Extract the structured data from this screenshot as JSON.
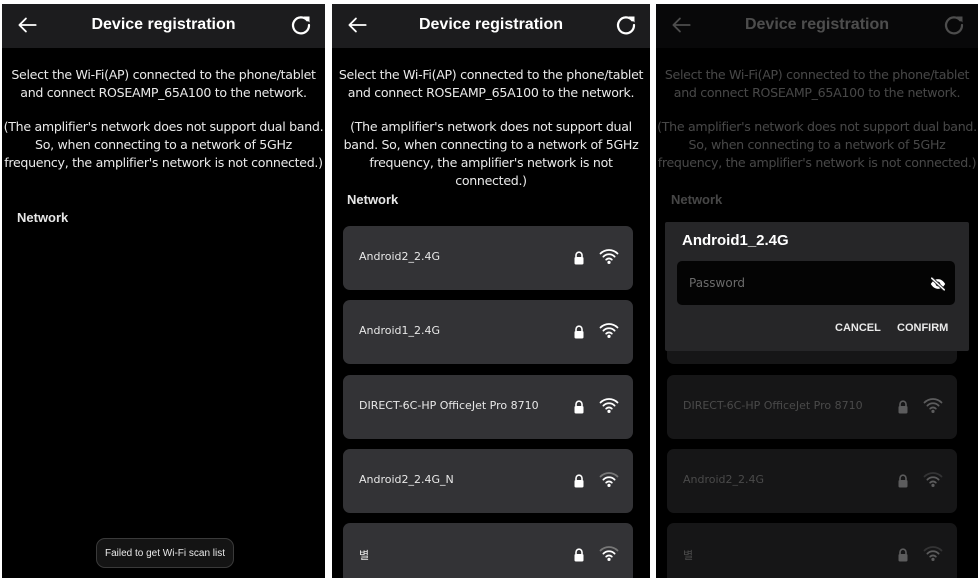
{
  "screens": [
    {
      "title": "Device registration",
      "description": [
        "Select the Wi-Fi(AP) connected to the phone/tablet and connect ROSEAMP_65A100 to the network.",
        "(The amplifier's network does not support dual band. So, when connecting to a network of 5GHz frequency, the amplifier's network is not connected.)"
      ],
      "network_label": "Network",
      "toast": "Failed to get Wi-Fi scan list"
    },
    {
      "title": "Device registration",
      "description": [
        "Select the Wi-Fi(AP) connected to the phone/tablet and connect ROSEAMP_65A100 to the network.",
        "(The amplifier's network does not support dual band. So, when connecting to a network of 5GHz frequency, the amplifier's network is not connected.)"
      ],
      "network_label": "Network",
      "networks": [
        {
          "ssid": "Android2_2.4G",
          "locked": true,
          "signal": "full"
        },
        {
          "ssid": "Android1_2.4G",
          "locked": true,
          "signal": "full"
        },
        {
          "ssid": "DIRECT-6C-HP OfficeJet Pro 8710",
          "locked": true,
          "signal": "full"
        },
        {
          "ssid": "Android2_2.4G_N",
          "locked": true,
          "signal": "medium"
        },
        {
          "ssid": "별",
          "locked": true,
          "signal": "medium"
        }
      ]
    },
    {
      "title": "Device registration",
      "description": [
        "Select the Wi-Fi(AP) connected to the phone/tablet and connect ROSEAMP_65A100 to the network.",
        "(The amplifier's network does not support dual band. So, when connecting to a network of 5GHz frequency, the amplifier's network is not connected.)"
      ],
      "network_label": "Network",
      "networks": [
        {
          "ssid": "DIRECT-6C-HP OfficeJet Pro 8710",
          "locked": true,
          "signal": "full"
        },
        {
          "ssid": "Android2_2.4G",
          "locked": true,
          "signal": "medium"
        },
        {
          "ssid": "별",
          "locked": true,
          "signal": "medium"
        }
      ],
      "dialog": {
        "title": "Android1_2.4G",
        "password_placeholder": "Password",
        "password_value": "",
        "cancel_label": "CANCEL",
        "confirm_label": "CONFIRM"
      }
    }
  ],
  "icons": {
    "back": "arrow-left-icon",
    "refresh": "refresh-icon",
    "lock": "lock-icon",
    "wifi": "wifi-icon",
    "visibility": "eye-off-icon"
  },
  "colors": {
    "background": "#000000",
    "appbar": "#1c1c1e",
    "card": "#333336",
    "dialog": "#262628",
    "text": "#ffffff"
  }
}
